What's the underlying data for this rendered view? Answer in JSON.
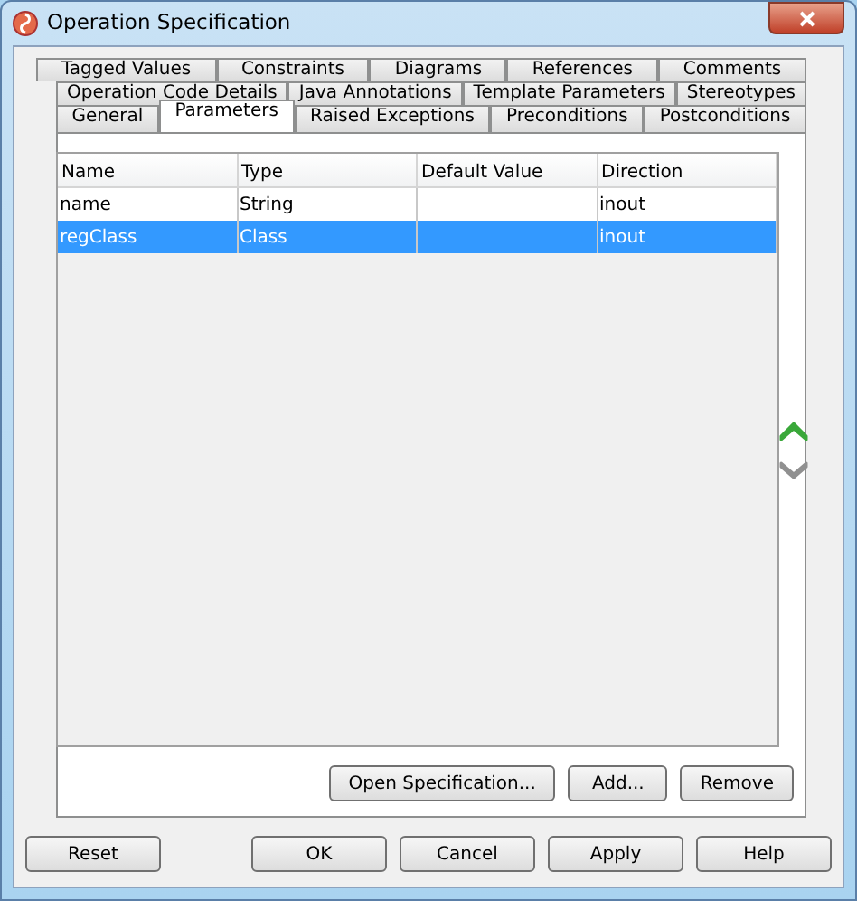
{
  "window": {
    "title": "Operation Specification"
  },
  "tab_rows": [
    [
      {
        "label": "Tagged Values",
        "selected": false
      },
      {
        "label": "Constraints",
        "selected": false
      },
      {
        "label": "Diagrams",
        "selected": false
      },
      {
        "label": "References",
        "selected": false
      },
      {
        "label": "Comments",
        "selected": false
      }
    ],
    [
      {
        "label": "Operation Code Details",
        "selected": false
      },
      {
        "label": "Java Annotations",
        "selected": false
      },
      {
        "label": "Template Parameters",
        "selected": false
      },
      {
        "label": "Stereotypes",
        "selected": false
      }
    ],
    [
      {
        "label": "General",
        "selected": false
      },
      {
        "label": "Parameters",
        "selected": true
      },
      {
        "label": "Raised Exceptions",
        "selected": false
      },
      {
        "label": "Preconditions",
        "selected": false
      },
      {
        "label": "Postconditions",
        "selected": false
      }
    ]
  ],
  "table": {
    "columns": [
      "Name",
      "Type",
      "Default Value",
      "Direction"
    ],
    "rows": [
      {
        "cells": [
          "name",
          "String",
          "",
          "inout"
        ],
        "selected": false
      },
      {
        "cells": [
          "regClass",
          "Class",
          "",
          "inout"
        ],
        "selected": true
      }
    ]
  },
  "move_buttons": [
    {
      "kind": "up",
      "disabled": false
    },
    {
      "kind": "down",
      "disabled": true
    }
  ],
  "panel_buttons": [
    "Open Specification...",
    "Add...",
    "Remove"
  ],
  "left_buttons": [
    "Reset"
  ],
  "dialog_buttons": [
    "OK",
    "Cancel",
    "Apply",
    "Help"
  ]
}
